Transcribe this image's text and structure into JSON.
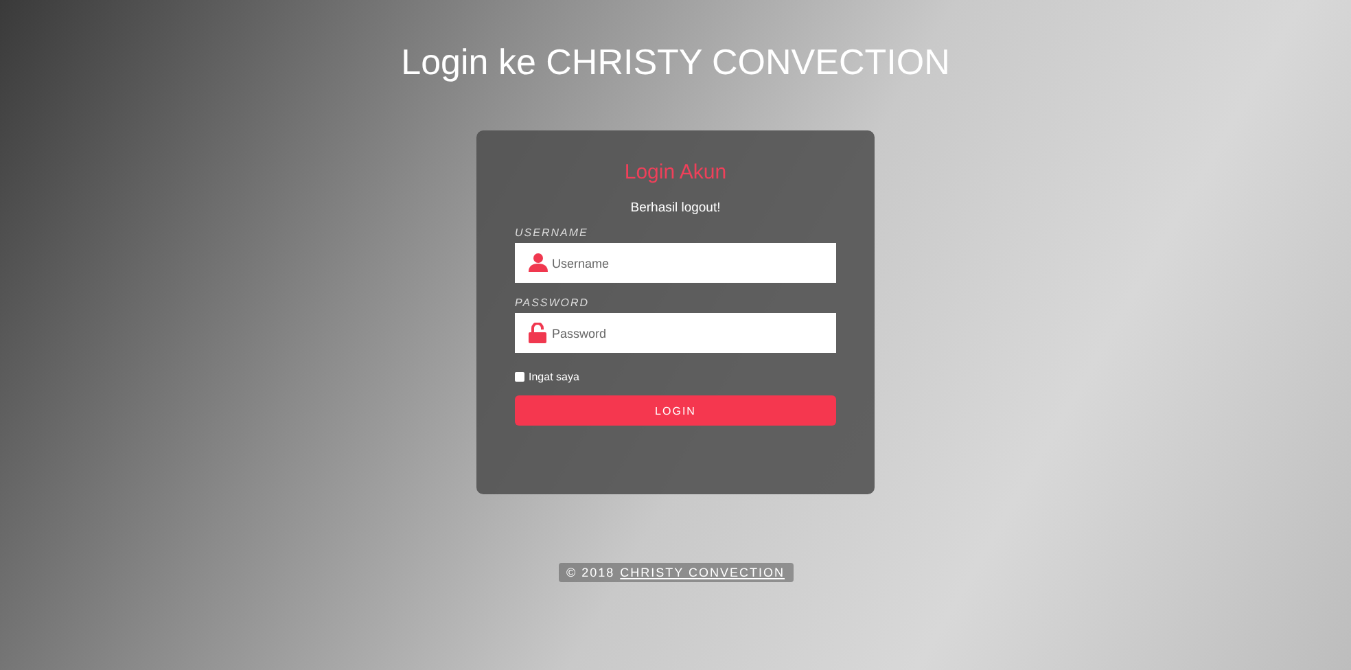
{
  "title": "Login ke CHRISTY CONVECTION",
  "form": {
    "heading": "Login Akun",
    "message": "Berhasil logout!",
    "fields": [
      {
        "kind": "text",
        "label": "USERNAME",
        "placeholder": "Username"
      },
      {
        "kind": "password",
        "label": "PASSWORD",
        "placeholder": "Password"
      }
    ],
    "remember": {
      "label": "Ingat saya",
      "checked": false
    },
    "button": "LOGIN"
  },
  "footer": {
    "copyright": "© 2018",
    "link": "CHRISTY CONVECTION"
  }
}
